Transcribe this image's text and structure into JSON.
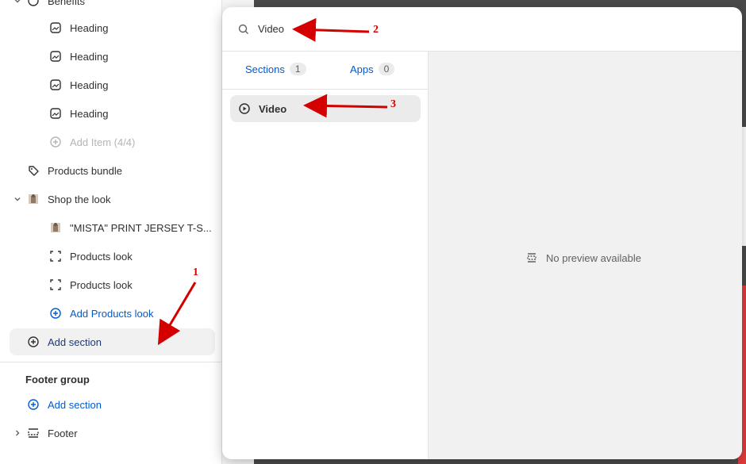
{
  "sidebar": {
    "benefits_label": "Benefits",
    "headings": [
      "Heading",
      "Heading",
      "Heading",
      "Heading"
    ],
    "add_item": "Add Item (4/4)",
    "products_bundle": "Products bundle",
    "shop_the_look": "Shop the look",
    "product_item": "\"MISTA\" PRINT JERSEY T-S...",
    "products_look_1": "Products look",
    "products_look_2": "Products look",
    "add_products_look": "Add Products look",
    "add_section": "Add section",
    "footer_group_title": "Footer group",
    "footer_add_section": "Add section",
    "footer": "Footer"
  },
  "popover": {
    "search_value": "Video",
    "tabs": [
      {
        "label": "Sections",
        "count": "1"
      },
      {
        "label": "Apps",
        "count": "0"
      }
    ],
    "result_label": "Video",
    "no_preview": "No preview available"
  },
  "annotations": [
    "1",
    "2",
    "3"
  ],
  "colors": {
    "accent_blue": "#005bd3",
    "annotation_red": "#d40000",
    "highlight_bg": "#f1f1f1"
  },
  "icons": {
    "heading": "image-icon",
    "add_item": "plus-circle-icon",
    "products_bundle": "tag-icon",
    "shop_the_look": "product-thumbnail-icon",
    "products_look": "dashed-frame-icon",
    "add": "plus-circle-icon",
    "footer": "footer-layout-icon",
    "search": "search-icon",
    "video": "play-circle-icon",
    "no_preview": "layout-icon"
  }
}
